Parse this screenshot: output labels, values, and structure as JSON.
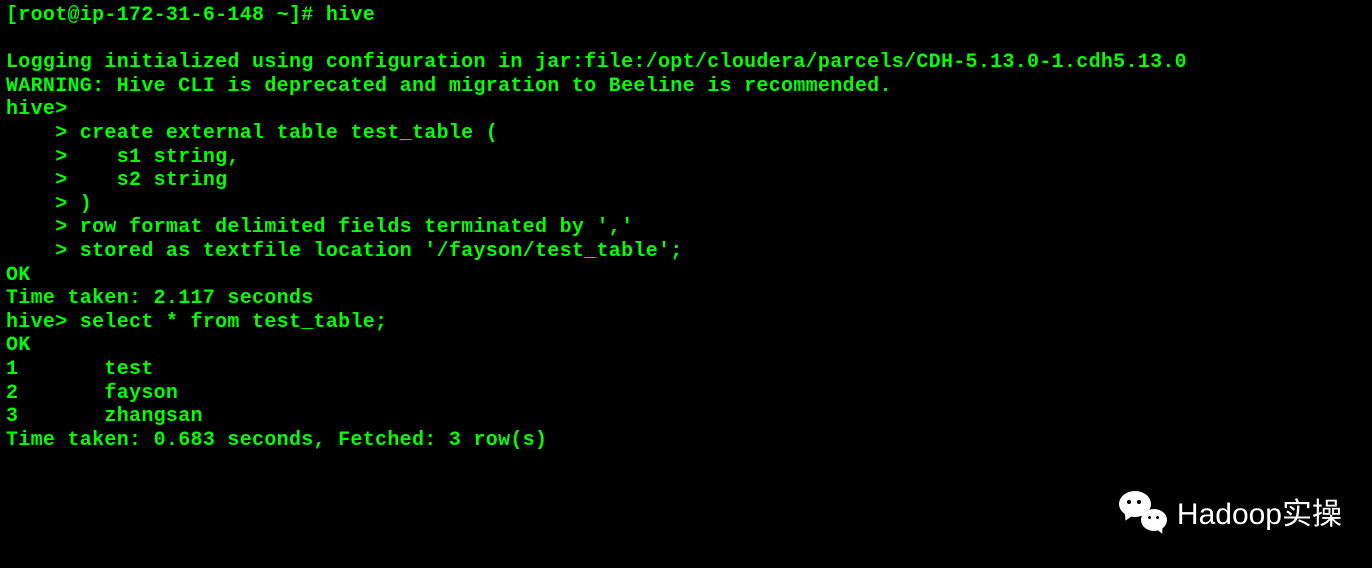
{
  "terminal": {
    "lines": [
      "[root@ip-172-31-6-148 ~]# hive",
      "",
      "Logging initialized using configuration in jar:file:/opt/cloudera/parcels/CDH-5.13.0-1.cdh5.13.0",
      "WARNING: Hive CLI is deprecated and migration to Beeline is recommended.",
      "hive>",
      "    > create external table test_table (",
      "    >    s1 string,",
      "    >    s2 string",
      "    > )",
      "    > row format delimited fields terminated by ','",
      "    > stored as textfile location '/fayson/test_table';",
      "OK",
      "Time taken: 2.117 seconds",
      "hive> select * from test_table;",
      "OK",
      "1       test",
      "2       fayson",
      "3       zhangsan",
      "Time taken: 0.683 seconds, Fetched: 3 row(s)"
    ]
  },
  "watermark": {
    "text": "Hadoop实操"
  }
}
